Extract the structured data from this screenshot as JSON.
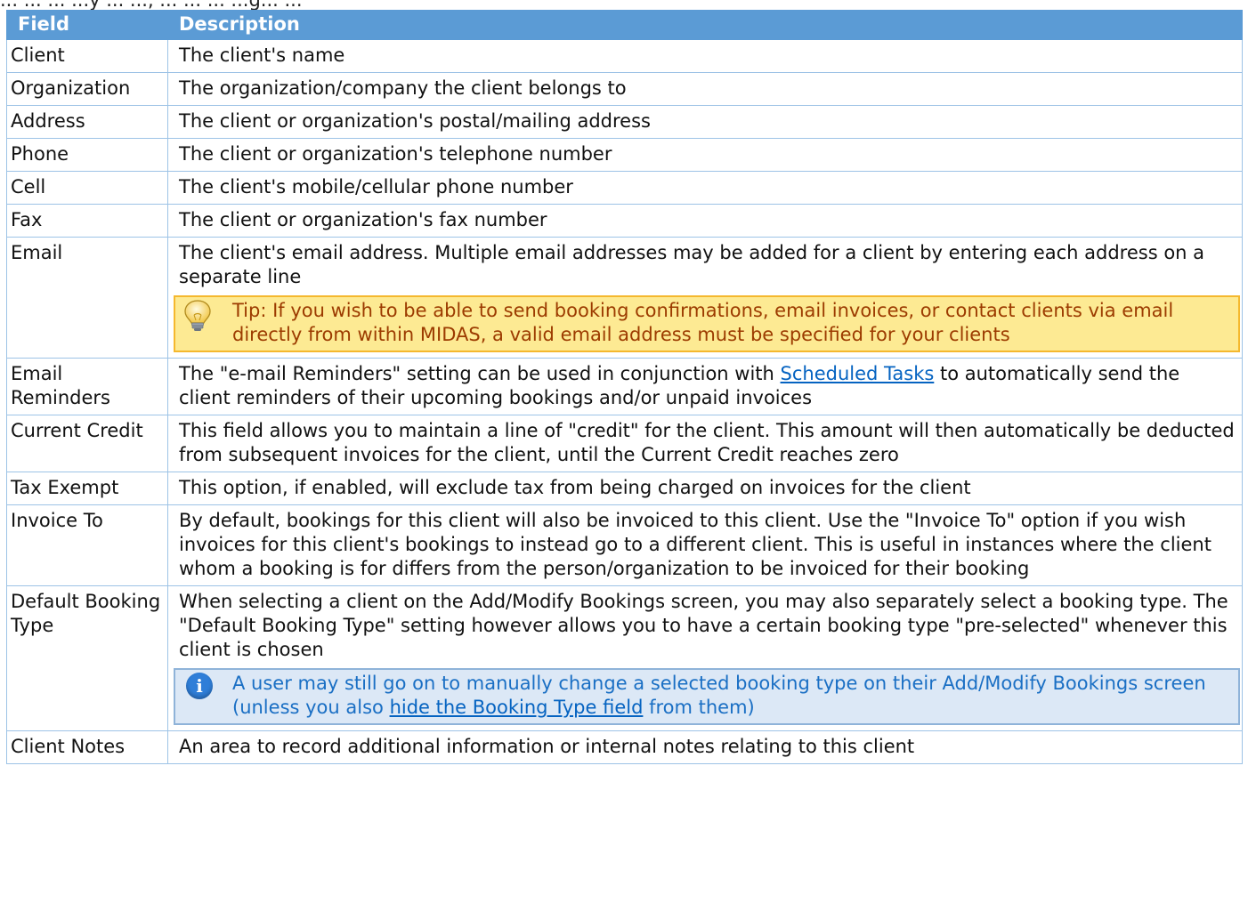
{
  "intro_fragment": "... ... ... ...y ... ..., ... ... ... ...g... ...",
  "table": {
    "header": {
      "field": "Field",
      "description": "Description"
    },
    "rows": {
      "client": {
        "field": "Client",
        "desc": "The client's name"
      },
      "organization": {
        "field": "Organization",
        "desc": "The organization/company the client belongs to"
      },
      "address": {
        "field": "Address",
        "desc": "The client or organization's postal/mailing address"
      },
      "phone": {
        "field": "Phone",
        "desc": "The client or organization's telephone number"
      },
      "cell": {
        "field": "Cell",
        "desc": "The client's mobile/cellular phone number"
      },
      "fax": {
        "field": "Fax",
        "desc": "The client or organization's fax number"
      },
      "email": {
        "field": "Email",
        "desc": "The client's email address. Multiple email addresses may be added for a client by entering each address on a separate line",
        "tip": "Tip: If you wish to be able to send booking confirmations, email invoices, or contact clients via email directly from within MIDAS, a valid email address must be specified for your clients"
      },
      "email_reminders": {
        "field": "Email Reminders",
        "desc_before": "The \"e-mail Reminders\" setting can be used in conjunction with ",
        "link": "Scheduled Tasks",
        "desc_after": " to automatically send the client reminders of their upcoming bookings and/or unpaid invoices"
      },
      "current_credit": {
        "field": "Current Credit",
        "desc": "This field allows you to maintain a line of \"credit\" for the client. This amount will then automatically be deducted from subsequent invoices for the client, until the Current Credit reaches zero"
      },
      "tax_exempt": {
        "field": "Tax Exempt",
        "desc": "This option, if enabled, will exclude tax from being charged on invoices for the client"
      },
      "invoice_to": {
        "field": "Invoice To",
        "desc": "By default, bookings for this client will also be invoiced to this client. Use the \"Invoice To\" option if you wish invoices for this client's bookings to instead go to a different client. This is useful in instances where the client whom a booking is for differs from the person/organization to be invoiced for their booking"
      },
      "default_booking_type": {
        "field": "Default Booking Type",
        "desc": "When selecting a client on the Add/Modify Bookings screen, you may also separately select a booking type. The \"Default Booking Type\" setting however allows you to have a certain booking type \"pre-selected\" whenever this client is chosen",
        "note_before": "A user may still go on to manually change a selected booking type on their Add/Modify Bookings screen (unless you also ",
        "note_link": "hide the Booking Type field",
        "note_after": " from them)"
      },
      "client_notes": {
        "field": "Client Notes",
        "desc": "An area to record additional information or internal notes relating to this client"
      }
    }
  },
  "colors": {
    "header_bg": "#5b9bd5",
    "border": "#9dc3e6",
    "tip_bg": "#fdea93",
    "tip_border": "#f5b82e",
    "tip_text": "#9c3b00",
    "info_bg": "#dce8f6",
    "info_border": "#8fb3d9",
    "info_text": "#1a6fc4",
    "link": "#0563c1"
  },
  "icons": {
    "tip": "lightbulb-icon",
    "note": "info-icon"
  }
}
